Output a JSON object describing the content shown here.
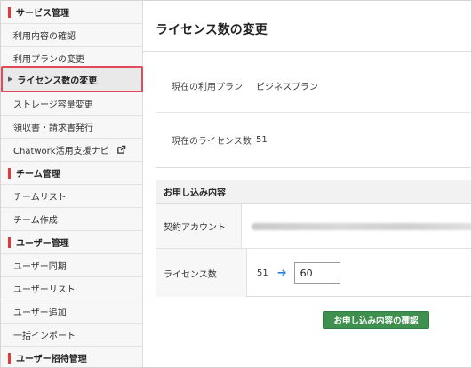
{
  "sidebar": {
    "sections": [
      {
        "heading": "サービス管理",
        "items": [
          {
            "label": "利用内容の確認"
          },
          {
            "label": "利用プランの変更"
          },
          {
            "label": "ライセンス数の変更",
            "active": true
          },
          {
            "label": "ストレージ容量変更"
          },
          {
            "label": "領収書・請求書発行"
          },
          {
            "label": "Chatwork活用支援ナビ",
            "icon": "external-link-icon"
          }
        ]
      },
      {
        "heading": "チーム管理",
        "items": [
          {
            "label": "チームリスト"
          },
          {
            "label": "チーム作成"
          }
        ]
      },
      {
        "heading": "ユーザー管理",
        "items": [
          {
            "label": "ユーザー同期"
          },
          {
            "label": "ユーザーリスト"
          },
          {
            "label": "ユーザー追加"
          },
          {
            "label": "一括インポート"
          }
        ]
      },
      {
        "heading": "ユーザー招待管理",
        "items": []
      }
    ]
  },
  "main": {
    "title": "ライセンス数の変更",
    "info": {
      "plan_label": "現在の利用プラン",
      "plan_value": "ビジネスプラン",
      "license_label": "現在のライセンス数",
      "license_value": "51"
    },
    "application": {
      "heading": "お申し込み内容",
      "account_label": "契約アカウント",
      "license_label": "ライセンス数",
      "current_count": "51",
      "new_count": "60"
    },
    "confirm_button": "お申し込み内容の確認"
  },
  "colors": {
    "accent_red": "#e03a3a",
    "highlight_border": "#e04a5a",
    "button_green": "#3f8f4f",
    "arrow_blue": "#2a7fd4"
  }
}
